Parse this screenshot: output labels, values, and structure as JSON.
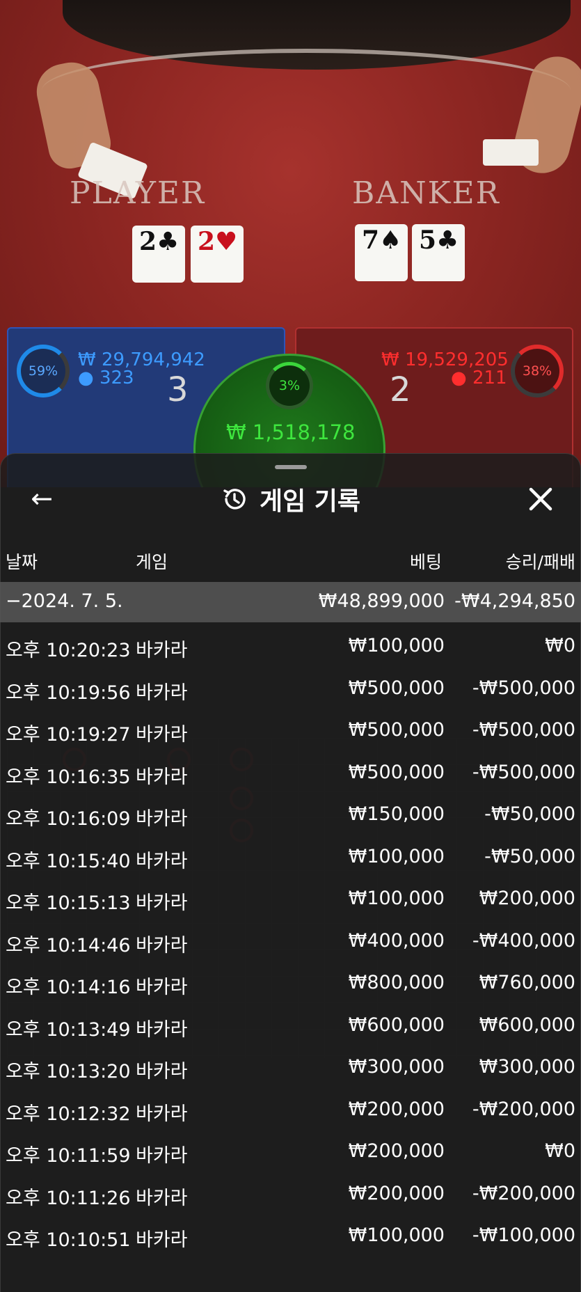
{
  "game_view": {
    "player_word": "PLAYER",
    "banker_word": "BANKER",
    "player_cards": [
      {
        "rank": "2",
        "suit": "♣",
        "color": "black"
      },
      {
        "rank": "2",
        "suit": "♥",
        "color": "red"
      }
    ],
    "banker_cards": [
      {
        "rank": "7",
        "suit": "♠",
        "color": "black"
      },
      {
        "rank": "5",
        "suit": "♣",
        "color": "black"
      }
    ],
    "player_percent": "59%",
    "player_amount": "₩ 29,794,942",
    "player_users": "323",
    "player_score": "3",
    "banker_percent": "38%",
    "banker_amount": "₩ 19,529,205",
    "banker_users": "211",
    "banker_score": "2",
    "tie_percent": "3%",
    "tie_amount": "₩ 1,518,178"
  },
  "modal": {
    "title": "게임 기록",
    "back_glyph": "←",
    "columns": {
      "date": "날짜",
      "game": "게임",
      "bet": "베팅",
      "result": "승리/패배"
    },
    "summary": {
      "date": "−2024. 7. 5.",
      "bet": "₩48,899,000",
      "result": "-₩4,294,850"
    },
    "rows": [
      {
        "time": "오후 10:20:23",
        "game": "바카라",
        "bet": "₩100,000",
        "result": "₩0"
      },
      {
        "time": "오후 10:19:56",
        "game": "바카라",
        "bet": "₩500,000",
        "result": "-₩500,000"
      },
      {
        "time": "오후 10:19:27",
        "game": "바카라",
        "bet": "₩500,000",
        "result": "-₩500,000"
      },
      {
        "time": "오후 10:16:35",
        "game": "바카라",
        "bet": "₩500,000",
        "result": "-₩500,000"
      },
      {
        "time": "오후 10:16:09",
        "game": "바카라",
        "bet": "₩150,000",
        "result": "-₩50,000"
      },
      {
        "time": "오후 10:15:40",
        "game": "바카라",
        "bet": "₩100,000",
        "result": "-₩50,000"
      },
      {
        "time": "오후 10:15:13",
        "game": "바카라",
        "bet": "₩100,000",
        "result": "₩200,000"
      },
      {
        "time": "오후 10:14:46",
        "game": "바카라",
        "bet": "₩400,000",
        "result": "-₩400,000"
      },
      {
        "time": "오후 10:14:16",
        "game": "바카라",
        "bet": "₩800,000",
        "result": "₩760,000"
      },
      {
        "time": "오후 10:13:49",
        "game": "바카라",
        "bet": "₩600,000",
        "result": "₩600,000"
      },
      {
        "time": "오후 10:13:20",
        "game": "바카라",
        "bet": "₩300,000",
        "result": "₩300,000"
      },
      {
        "time": "오후 10:12:32",
        "game": "바카라",
        "bet": "₩200,000",
        "result": "-₩200,000"
      },
      {
        "time": "오후 10:11:59",
        "game": "바카라",
        "bet": "₩200,000",
        "result": "₩0"
      },
      {
        "time": "오후 10:11:26",
        "game": "바카라",
        "bet": "₩200,000",
        "result": "-₩200,000"
      },
      {
        "time": "오후 10:10:51",
        "game": "바카라",
        "bet": "₩100,000",
        "result": "-₩100,000"
      }
    ]
  },
  "colors": {
    "blue": "#3d9bff",
    "red": "#ff2e2e",
    "green": "#3ee63e",
    "sheet": "#1c1c1c"
  }
}
